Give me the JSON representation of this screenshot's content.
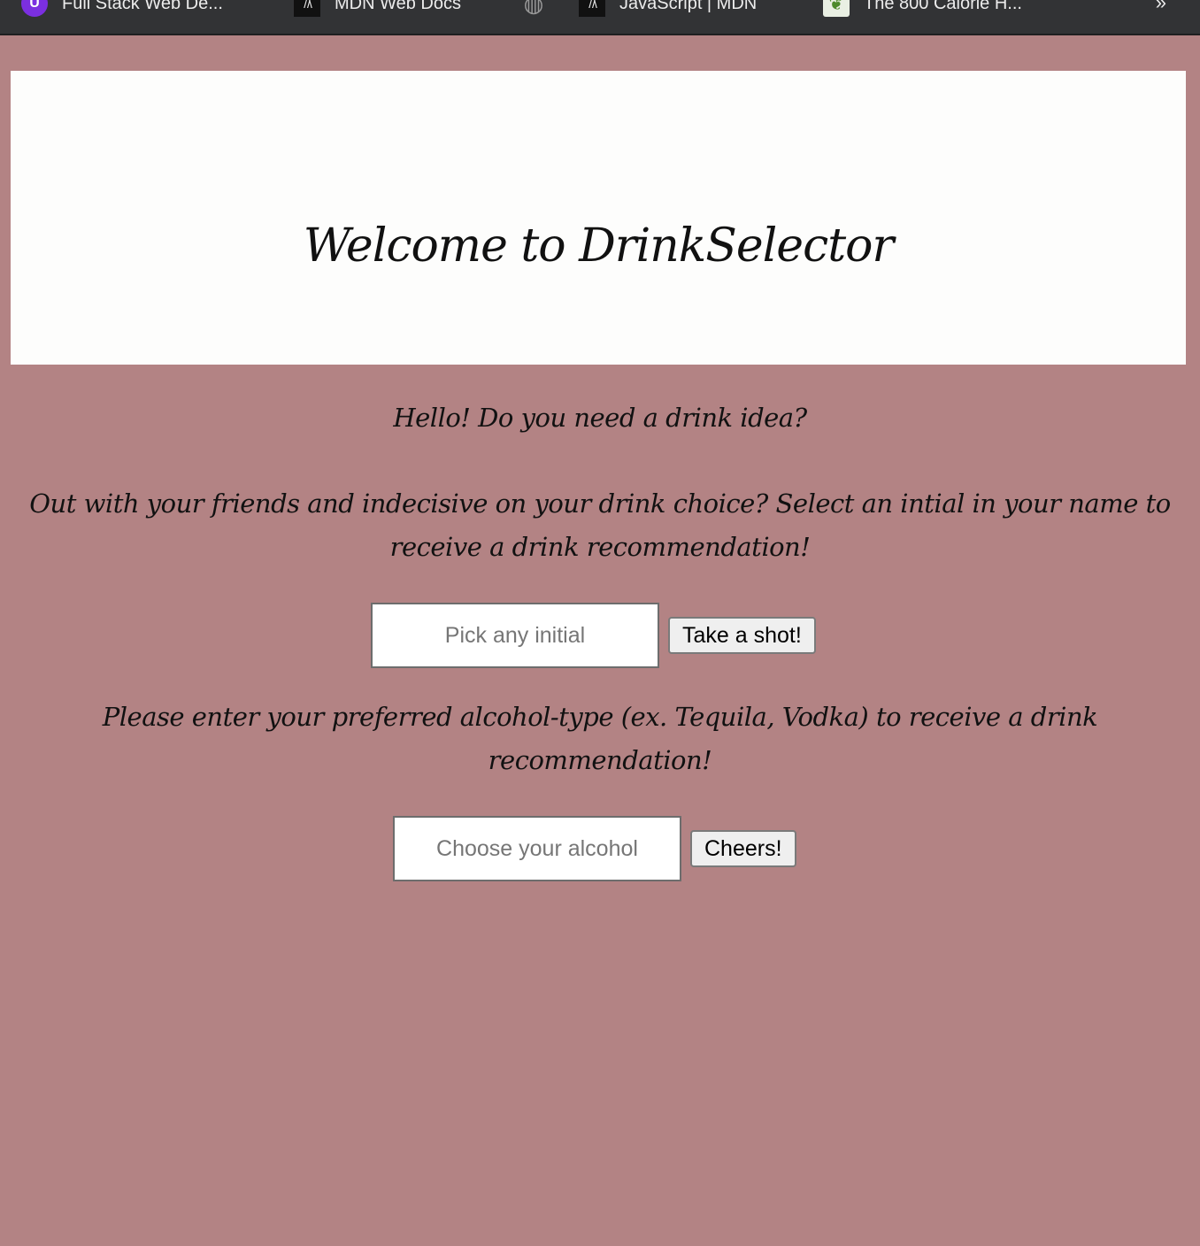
{
  "bookmarks": [
    {
      "label": "Full Stack Web De...",
      "icon": "purple-circle-icon"
    },
    {
      "label": "MDN Web Docs",
      "icon": "mdn-icon"
    },
    {
      "label": "",
      "icon": "globe-icon"
    },
    {
      "label": "JavaScript | MDN",
      "icon": "mdn-icon"
    },
    {
      "label": "The 800 Calorie H...",
      "icon": "leaf-icon"
    }
  ],
  "bookmarks_overflow": "»",
  "header": {
    "title": "Welcome to DrinkSelector"
  },
  "main": {
    "greeting": "Hello! Do you need a drink idea?",
    "initial_instructions": "Out with your friends and indecisive on your drink choice? Select an intial in your name to receive a drink recommendation!",
    "initial_input": {
      "value": "",
      "placeholder": "Pick any initial"
    },
    "initial_button": "Take a shot!",
    "alcohol_instructions": "Please enter your preferred alcohol-type (ex. Tequila, Vodka) to receive a drink recommendation!",
    "alcohol_input": {
      "value": "",
      "placeholder": "Choose your alcohol"
    },
    "alcohol_button": "Cheers!"
  },
  "colors": {
    "page_background": "#b38384",
    "header_background": "#fdfdfc",
    "bookmarks_bar": "#323335"
  }
}
